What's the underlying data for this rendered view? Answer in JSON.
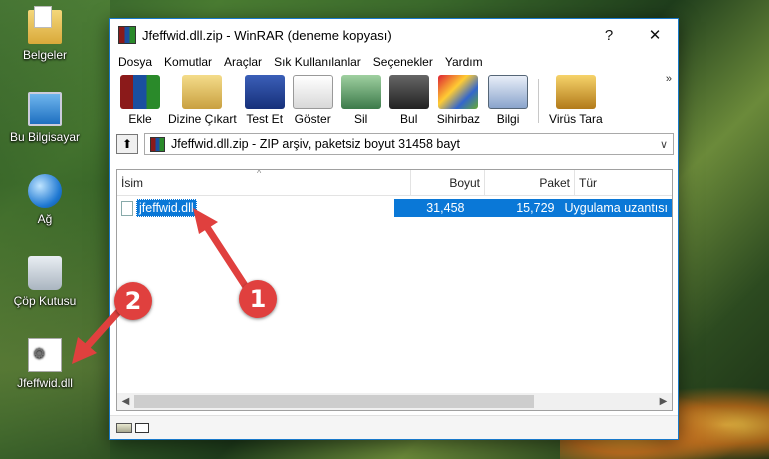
{
  "desktop": {
    "icons": [
      {
        "label": "Belgeler",
        "icon": "documents-folder-icon"
      },
      {
        "label": "Bu Bilgisayar",
        "icon": "computer-icon"
      },
      {
        "label": "Ağ",
        "icon": "network-icon"
      },
      {
        "label": "Çöp Kutusu",
        "icon": "recycle-bin-icon"
      },
      {
        "label": "Jfeffwid.dll",
        "icon": "dll-file-icon"
      }
    ]
  },
  "window": {
    "title": "Jfeffwid.dll.zip - WinRAR (deneme kopyası)",
    "help_glyph": "?",
    "close_glyph": "✕"
  },
  "menu": [
    "Dosya",
    "Komutlar",
    "Araçlar",
    "Sık Kullanılanlar",
    "Seçenekler",
    "Yardım"
  ],
  "toolbar": {
    "buttons": [
      {
        "label": "Ekle",
        "icon": "add-archive-icon"
      },
      {
        "label": "Dizine Çıkart",
        "icon": "extract-to-folder-icon"
      },
      {
        "label": "Test Et",
        "icon": "test-archive-icon"
      },
      {
        "label": "Göster",
        "icon": "view-glasses-icon"
      },
      {
        "label": "Sil",
        "icon": "delete-icon"
      },
      {
        "label": "Bul",
        "icon": "find-binoculars-icon"
      },
      {
        "label": "Sihirbaz",
        "icon": "wizard-icon"
      },
      {
        "label": "Bilgi",
        "icon": "info-icon"
      },
      {
        "label": "Virüs Tara",
        "icon": "virus-scan-icon"
      }
    ],
    "more_glyph": "»"
  },
  "address": {
    "up_glyph": "⬆",
    "text": "Jfeffwid.dll.zip - ZIP arşiv, paketsiz boyut 31458 bayt",
    "dropdown_glyph": "∨"
  },
  "list": {
    "sort_glyph": "^",
    "columns": {
      "name": "İsim",
      "size": "Boyut",
      "packed": "Paket",
      "type": "Tür"
    },
    "rows": [
      {
        "name": "jfeffwid.dll",
        "size": "31,458",
        "packed": "15,729",
        "type": "Uygulama uzantısı",
        "selected": true
      }
    ]
  },
  "scrollbar": {
    "left": "◀",
    "right": "▶"
  },
  "annotations": {
    "badge1": "1",
    "badge2": "2",
    "color": "#e0403e"
  }
}
